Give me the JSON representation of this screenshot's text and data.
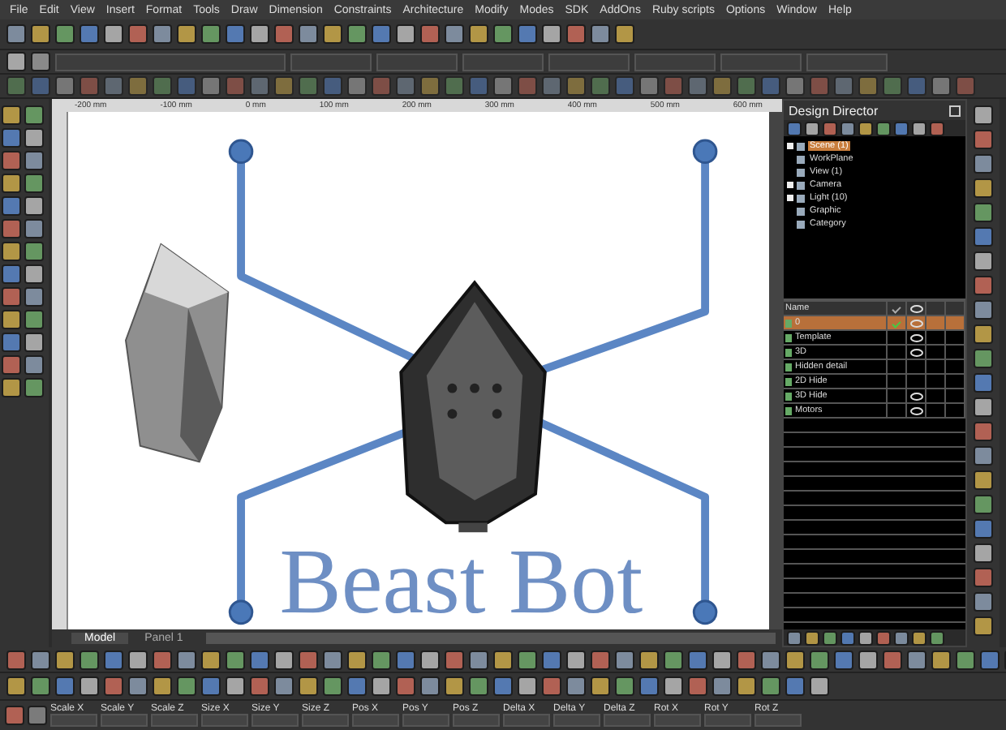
{
  "menu": [
    "File",
    "Edit",
    "View",
    "Insert",
    "Format",
    "Tools",
    "Draw",
    "Dimension",
    "Constraints",
    "Architecture",
    "Modify",
    "Modes",
    "SDK",
    "AddOns",
    "Ruby scripts",
    "Options",
    "Window",
    "Help"
  ],
  "ruler": [
    "-200 mm",
    "-100 mm",
    "0 mm",
    "100 mm",
    "200 mm",
    "300 mm",
    "400 mm",
    "500 mm",
    "600 mm"
  ],
  "canvas": {
    "title_text": "Beast Bot"
  },
  "view_tabs": [
    {
      "label": "Model",
      "selected": true
    },
    {
      "label": "Panel 1",
      "selected": false
    }
  ],
  "design_director": {
    "title": "Design Director",
    "tree": [
      {
        "label": "Scene (1)",
        "selected": true,
        "expandable": true
      },
      {
        "label": "WorkPlane",
        "selected": false,
        "expandable": false
      },
      {
        "label": "View (1)",
        "selected": false,
        "expandable": false
      },
      {
        "label": "Camera",
        "selected": false,
        "expandable": true
      },
      {
        "label": "Light (10)",
        "selected": false,
        "expandable": true
      },
      {
        "label": "Graphic",
        "selected": false,
        "expandable": false
      },
      {
        "label": "Category",
        "selected": false,
        "expandable": false
      }
    ],
    "layer_header": "Name",
    "layers": [
      {
        "name": "0",
        "selected": true,
        "current": true,
        "visible": true
      },
      {
        "name": "Template",
        "selected": false,
        "current": false,
        "visible": true
      },
      {
        "name": "3D",
        "selected": false,
        "current": false,
        "visible": true
      },
      {
        "name": "Hidden detail",
        "selected": false,
        "current": false,
        "visible": false
      },
      {
        "name": "2D Hide",
        "selected": false,
        "current": false,
        "visible": false
      },
      {
        "name": "3D Hide",
        "selected": false,
        "current": false,
        "visible": true
      },
      {
        "name": "Motors",
        "selected": false,
        "current": false,
        "visible": true
      }
    ]
  },
  "status_fields": [
    "Scale X",
    "Scale Y",
    "Scale Z",
    "Size X",
    "Size Y",
    "Size Z",
    "Pos X",
    "Pos Y",
    "Pos Z",
    "Delta X",
    "Delta Y",
    "Delta Z",
    "Rot X",
    "Rot Y",
    "Rot Z"
  ]
}
